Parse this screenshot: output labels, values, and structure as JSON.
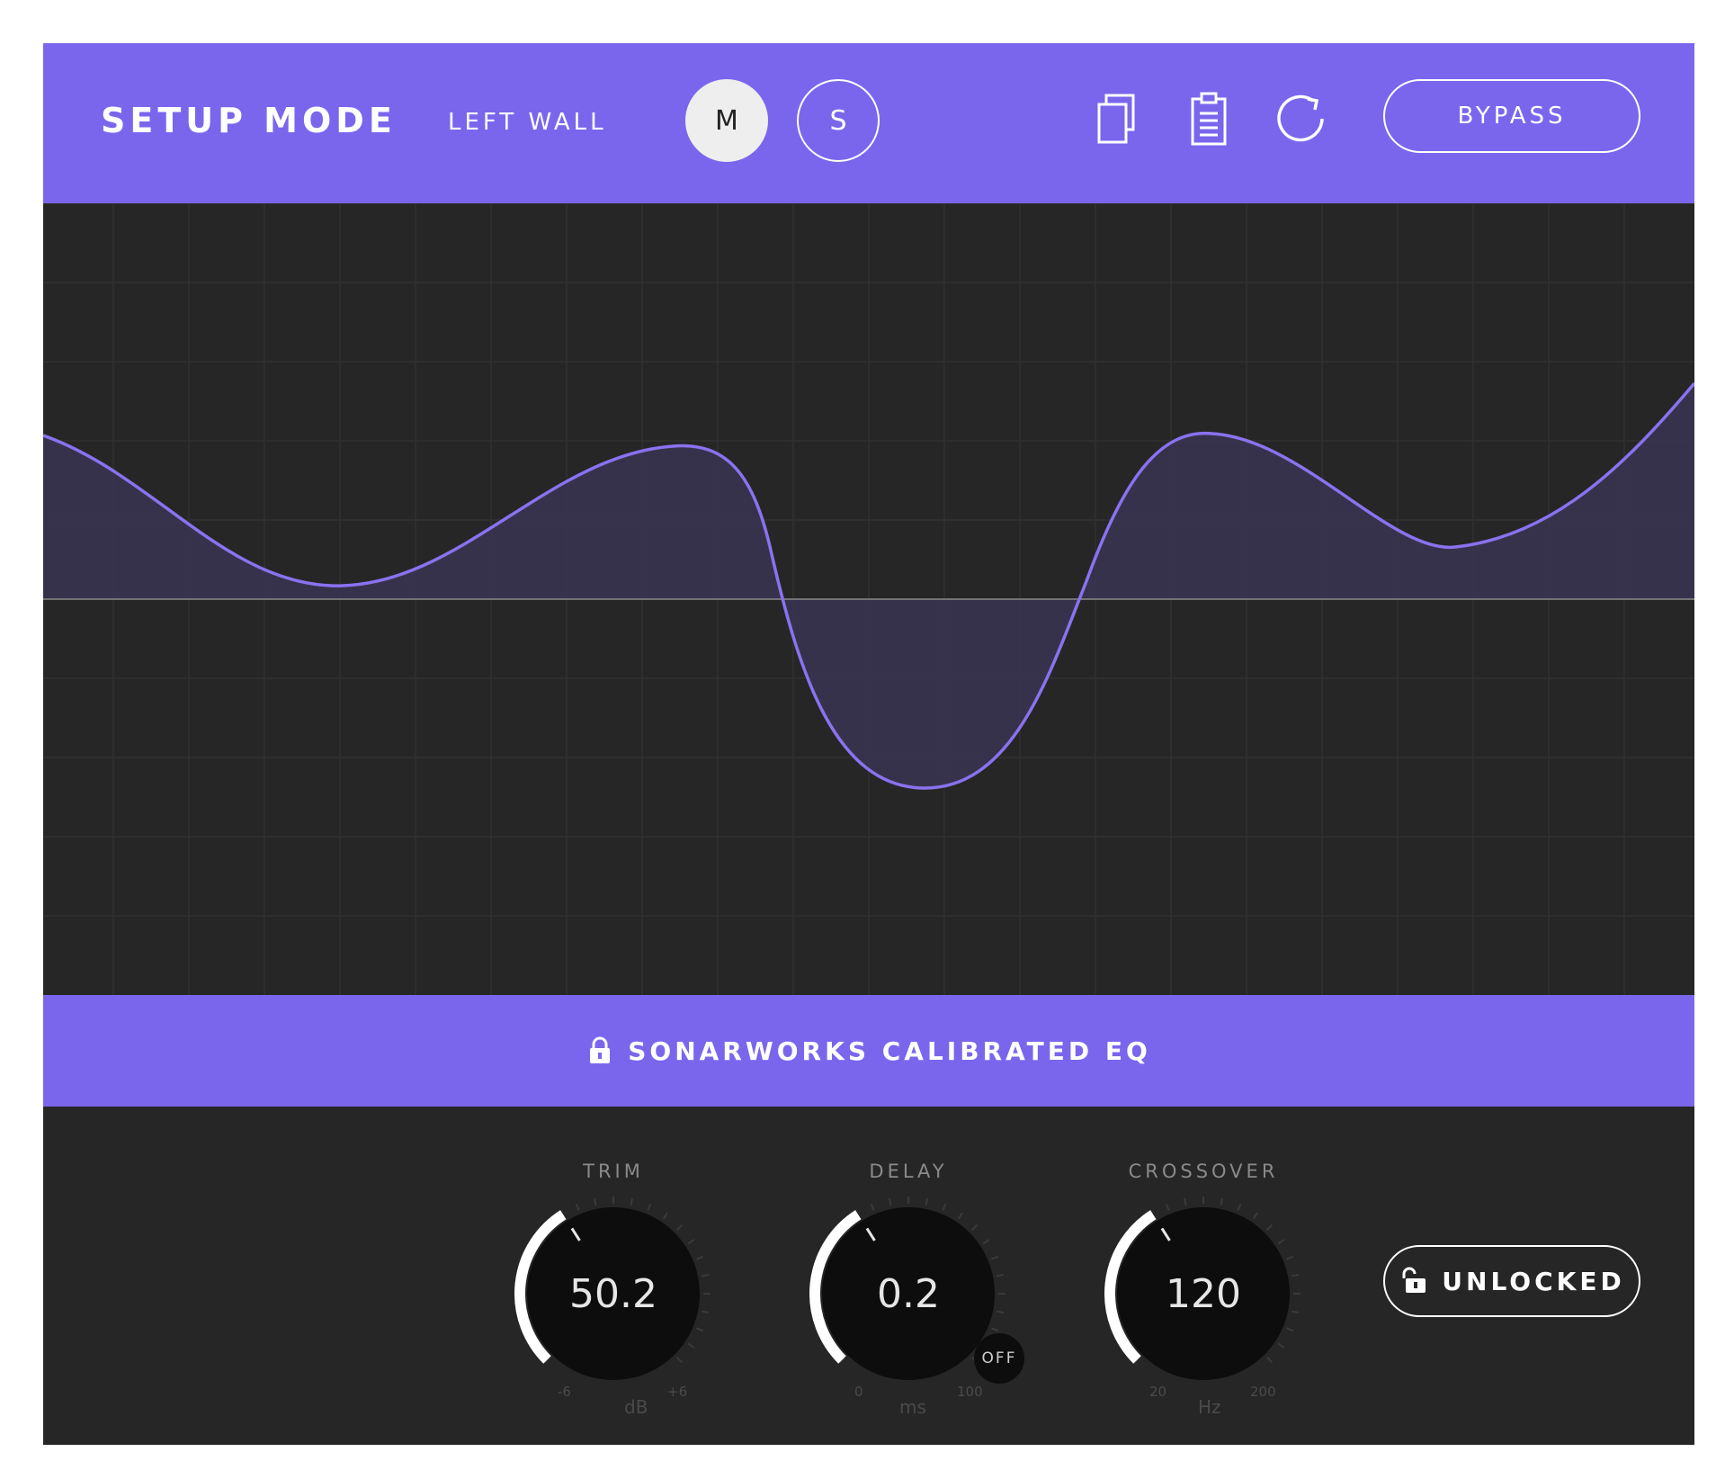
{
  "header": {
    "title": "SETUP MODE",
    "speaker": "LEFT WALL",
    "mid_button": "M",
    "side_button": "S",
    "bypass_label": "BYPASS",
    "icons": [
      "copy-icon",
      "paste-icon",
      "reset-icon"
    ]
  },
  "graph": {
    "curve_color": "#8A72F0",
    "fill_color": "#3A3450",
    "zero_line_color": "#8a8a8a",
    "grid": true
  },
  "preset": {
    "icon": "lock-icon",
    "name": "SONARWORKS CALIBRATED EQ"
  },
  "knobs": [
    {
      "id": "trim",
      "label": "TRIM",
      "value": "50.2",
      "min_label": "-6",
      "max_label": "+6",
      "unit": "dB",
      "level": 0.38
    },
    {
      "id": "delay",
      "label": "DELAY",
      "value": "0.2",
      "min_label": "0",
      "max_label": "100",
      "unit": "ms",
      "level": 0.38
    },
    {
      "id": "crossover",
      "label": "CROSSOVER",
      "value": "120",
      "min_label": "20",
      "max_label": "200",
      "unit": "Hz",
      "level": 0.38
    }
  ],
  "delay_toggle": "OFF",
  "lock_button": {
    "label": "UNLOCKED",
    "icon": "unlock-icon"
  },
  "colors": {
    "accent": "#7A66ED",
    "panel": "#262626",
    "knob": "#0d0d0d",
    "knob_arc": "#ffffff"
  }
}
